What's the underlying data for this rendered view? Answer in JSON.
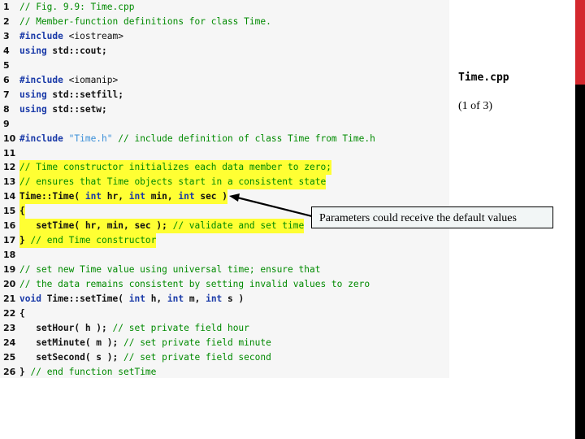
{
  "slide": {
    "file_title": "Time.cpp",
    "page_indicator": "(1 of 3)",
    "callout_text": "Parameters could receive the default values",
    "accent_colors": {
      "top_bar": "#d4282e",
      "side_bar": "#000000",
      "highlight": "#ffff33"
    }
  },
  "code": {
    "lines": [
      {
        "n": "1",
        "hl": false,
        "segs": [
          {
            "t": "// Fig. 9.9: Time.cpp",
            "c": "cm"
          }
        ]
      },
      {
        "n": "2",
        "hl": false,
        "segs": [
          {
            "t": "// Member-function definitions for class Time.",
            "c": "cm"
          }
        ]
      },
      {
        "n": "3",
        "hl": false,
        "segs": [
          {
            "t": "#include ",
            "c": "pp"
          },
          {
            "t": "<iostream>",
            "c": "tx-n"
          }
        ]
      },
      {
        "n": "4",
        "hl": false,
        "segs": [
          {
            "t": "using ",
            "c": "kw"
          },
          {
            "t": "std::cout;",
            "c": "tx"
          }
        ]
      },
      {
        "n": "5",
        "hl": false,
        "segs": []
      },
      {
        "n": "6",
        "hl": false,
        "segs": [
          {
            "t": "#include ",
            "c": "pp"
          },
          {
            "t": "<iomanip>",
            "c": "tx-n"
          }
        ]
      },
      {
        "n": "7",
        "hl": false,
        "segs": [
          {
            "t": "using ",
            "c": "kw"
          },
          {
            "t": "std::setfill;",
            "c": "tx"
          }
        ]
      },
      {
        "n": "8",
        "hl": false,
        "segs": [
          {
            "t": "using ",
            "c": "kw"
          },
          {
            "t": "std::setw;",
            "c": "tx"
          }
        ]
      },
      {
        "n": "9",
        "hl": false,
        "segs": []
      },
      {
        "n": "10",
        "hl": false,
        "segs": [
          {
            "t": "#include ",
            "c": "pp"
          },
          {
            "t": "\"Time.h\"",
            "c": "str"
          },
          {
            "t": " // include definition of class Time from Time.h",
            "c": "cm"
          }
        ]
      },
      {
        "n": "11",
        "hl": false,
        "segs": []
      },
      {
        "n": "12",
        "hl": true,
        "segs": [
          {
            "t": "// Time constructor initializes each data member to zero;",
            "c": "cm"
          }
        ]
      },
      {
        "n": "13",
        "hl": true,
        "segs": [
          {
            "t": "// ensures that Time objects start in a consistent state",
            "c": "cm"
          }
        ]
      },
      {
        "n": "14",
        "hl": true,
        "segs": [
          {
            "t": "Time::Time( ",
            "c": "tx"
          },
          {
            "t": "int ",
            "c": "kw"
          },
          {
            "t": "hr, ",
            "c": "tx"
          },
          {
            "t": "int ",
            "c": "kw"
          },
          {
            "t": "min, ",
            "c": "tx"
          },
          {
            "t": "int ",
            "c": "kw"
          },
          {
            "t": "sec )",
            "c": "tx"
          }
        ]
      },
      {
        "n": "15",
        "hl": true,
        "segs": [
          {
            "t": "{",
            "c": "tx"
          }
        ]
      },
      {
        "n": "16",
        "hl": true,
        "segs": [
          {
            "t": "   setTime( hr, min, sec ); ",
            "c": "tx"
          },
          {
            "t": "// validate and set time",
            "c": "cm"
          }
        ]
      },
      {
        "n": "17",
        "hl": true,
        "segs": [
          {
            "t": "} ",
            "c": "tx"
          },
          {
            "t": "// end Time constructor",
            "c": "cm"
          }
        ]
      },
      {
        "n": "18",
        "hl": false,
        "segs": []
      },
      {
        "n": "19",
        "hl": false,
        "segs": [
          {
            "t": "// set new Time value using universal time; ensure that",
            "c": "cm"
          }
        ]
      },
      {
        "n": "20",
        "hl": false,
        "segs": [
          {
            "t": "// the data remains consistent by setting invalid values to zero",
            "c": "cm"
          }
        ]
      },
      {
        "n": "21",
        "hl": false,
        "segs": [
          {
            "t": "void ",
            "c": "kw"
          },
          {
            "t": "Time::setTime( ",
            "c": "tx"
          },
          {
            "t": "int ",
            "c": "kw"
          },
          {
            "t": "h, ",
            "c": "tx"
          },
          {
            "t": "int ",
            "c": "kw"
          },
          {
            "t": "m, ",
            "c": "tx"
          },
          {
            "t": "int ",
            "c": "kw"
          },
          {
            "t": "s )",
            "c": "tx"
          }
        ]
      },
      {
        "n": "22",
        "hl": false,
        "segs": [
          {
            "t": "{",
            "c": "tx"
          }
        ]
      },
      {
        "n": "23",
        "hl": false,
        "segs": [
          {
            "t": "   setHour( h ); ",
            "c": "tx"
          },
          {
            "t": "// set private field hour",
            "c": "cm"
          }
        ]
      },
      {
        "n": "24",
        "hl": false,
        "segs": [
          {
            "t": "   setMinute( m ); ",
            "c": "tx"
          },
          {
            "t": "// set private field minute",
            "c": "cm"
          }
        ]
      },
      {
        "n": "25",
        "hl": false,
        "segs": [
          {
            "t": "   setSecond( s ); ",
            "c": "tx"
          },
          {
            "t": "// set private field second",
            "c": "cm"
          }
        ]
      },
      {
        "n": "26",
        "hl": false,
        "segs": [
          {
            "t": "} ",
            "c": "tx"
          },
          {
            "t": "// end function setTime",
            "c": "cm"
          }
        ]
      }
    ]
  }
}
